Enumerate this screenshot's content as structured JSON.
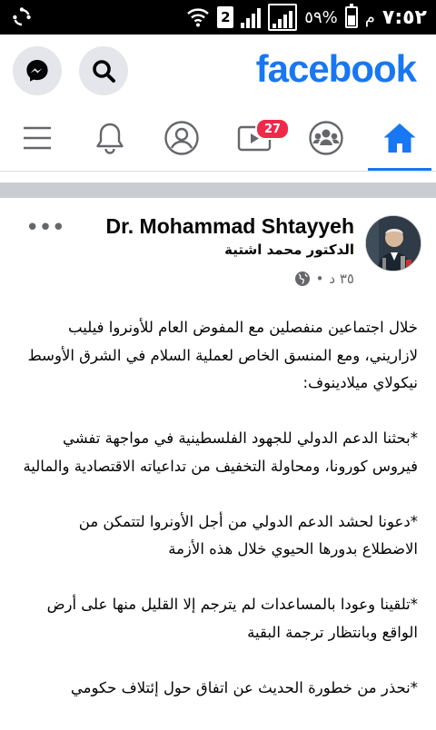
{
  "status_bar": {
    "time": "٧:٥٢",
    "ampm": "م",
    "battery": "٥٩%",
    "sim": "2"
  },
  "header": {
    "logo": "facebook",
    "icons": {
      "messenger": "messenger-icon",
      "search": "search-icon"
    }
  },
  "tabs": {
    "watch_badge": "27",
    "active": "home"
  },
  "post": {
    "author": "Dr. Mohammad Shtayyeh",
    "author_ar": "الدكتور محمد اشتية",
    "time": "٣٥ د",
    "separator": "•",
    "paragraphs": [
      "خلال اجتماعين منفصلين مع المفوض العام للأونروا فيليب لازاريني، ومع المنسق الخاص لعملية السلام في الشرق الأوسط نيكولاي ميلادينوف:",
      "*بحثنا الدعم الدولي للجهود الفلسطينية في مواجهة تفشي فيروس كورونا، ومحاولة التخفيف من تداعياته الاقتصادية والمالية",
      "*دعونا لحشد الدعم الدولي من أجل الأونروا لتتمكن من الاضطلاع بدورها الحيوي خلال هذه الأزمة",
      "*تلقينا وعودا بالمساعدات لم يترجم إلا القليل منها على أرض الواقع وبانتظار ترجمة البقية",
      "*نحذر من خطورة الحديث عن اتفاق حول إئتلاف حكومي"
    ]
  },
  "colors": {
    "brand": "#1877f2",
    "badge": "#f02849"
  }
}
